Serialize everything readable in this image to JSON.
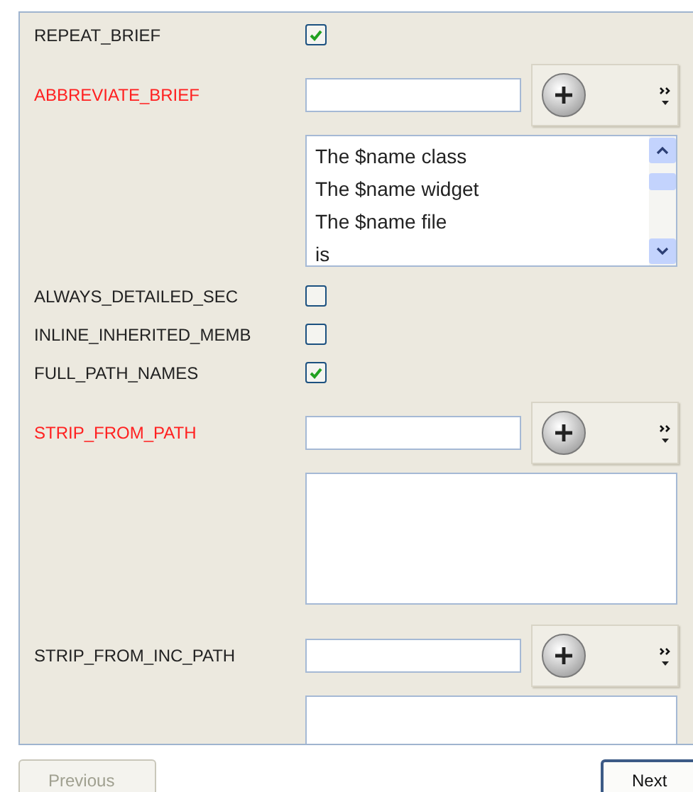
{
  "settings": [
    {
      "kind": "checkbox",
      "label": "REPEAT_BRIEF",
      "changed": false,
      "checked": true
    },
    {
      "kind": "list",
      "label": "ABBREVIATE_BRIEF",
      "changed": true,
      "entries": [
        "The $name class",
        "The $name widget",
        "The $name file",
        "is"
      ]
    },
    {
      "kind": "checkbox",
      "label": "ALWAYS_DETAILED_SEC",
      "changed": false,
      "checked": false
    },
    {
      "kind": "checkbox",
      "label": "INLINE_INHERITED_MEMB",
      "changed": false,
      "checked": false
    },
    {
      "kind": "checkbox",
      "label": "FULL_PATH_NAMES",
      "changed": false,
      "checked": true
    },
    {
      "kind": "list",
      "label": "STRIP_FROM_PATH",
      "changed": true
    },
    {
      "kind": "list",
      "label": "STRIP_FROM_INC_PATH",
      "changed": false
    }
  ],
  "buttons": [
    {
      "label": "Previous",
      "disabled": true
    },
    {
      "label": "Next",
      "disabled": false
    }
  ]
}
